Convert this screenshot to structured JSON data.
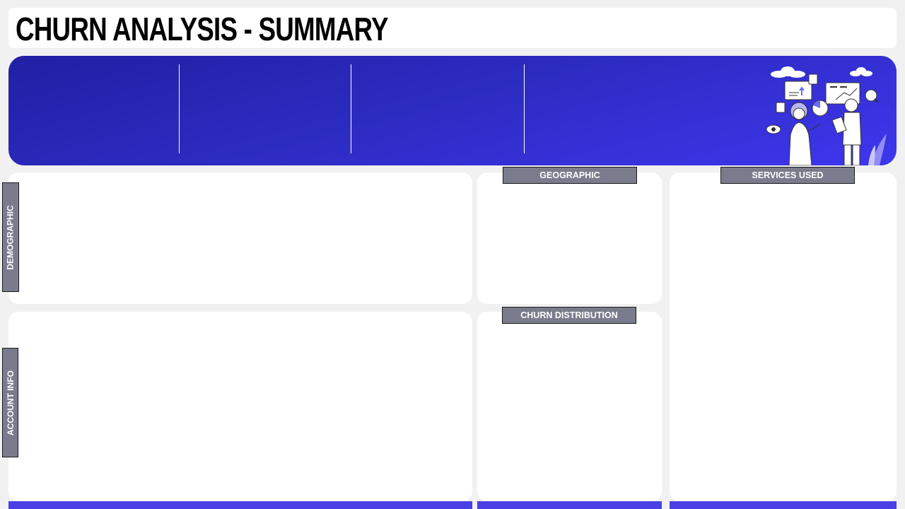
{
  "header": {
    "title": "CHURN ANALYSIS - SUMMARY"
  },
  "panels": {
    "demographic": {
      "label": "DEMOGRAPHIC"
    },
    "account_info": {
      "label": "ACCOUNT INFO"
    },
    "geographic": {
      "label": "GEOGRAPHIC"
    },
    "churn_distribution": {
      "label": "CHURN DISTRIBUTION"
    },
    "services_used": {
      "label": "SERVICES USED"
    }
  },
  "colors": {
    "page_background": "#f1f1f1",
    "banner_gradient_start": "#211fa3",
    "banner_gradient_end": "#3f36ee",
    "label_fill": "#7a7b8c",
    "accent_strip": "#4a40e6"
  },
  "banner": {
    "illustration": "analytics-team-illustration"
  }
}
